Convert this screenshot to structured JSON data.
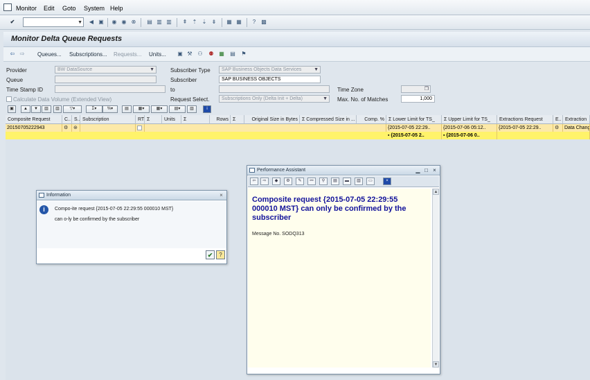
{
  "menu": [
    "Monitor",
    "Edit",
    "Goto",
    "System",
    "Help"
  ],
  "title": "Monitor Delta Queue Requests",
  "app_toolbar": {
    "queues": "Queues...",
    "subscriptions": "Subscriptions...",
    "requests": "Requests...",
    "units": "Units..."
  },
  "form": {
    "provider_label": "Provider",
    "provider_value": "BW DataSource",
    "queue_label": "Queue",
    "timestamp_label": "Time Stamp ID",
    "calc_label": "Calculate Data Volume (Extended View)",
    "subtype_label": "Subscriber Type",
    "subtype_value": "SAP Business Objects Data Services",
    "subscriber_label": "Subscriber",
    "subscriber_value": "SAP BUSINESS OBJECTS",
    "to_label": "to",
    "reqsel_label": "Request Select.",
    "reqsel_value": "Subscriptions Only (Delta Init + Delta)",
    "timezone_label": "Time Zone",
    "maxmatch_label": "Max. No. of Matches",
    "maxmatch_value": "1,000"
  },
  "grid": {
    "headers": [
      "Composite Request",
      "C..",
      "S..",
      "Subscription",
      "RT",
      "Σ",
      "Units",
      "Σ",
      "Rows",
      "Σ",
      "Original Size in Bytes",
      "Σ Compressed Size in ...",
      "Comp. %",
      "Σ Lower Limit for TS_",
      "Σ Upper Limit for TS_",
      "Extractions Request",
      "E..",
      "Extraction"
    ],
    "row1": {
      "composite": "20150705222943",
      "lower": "{2015-07-05 22:29..",
      "upper": "{2015-07-06 05:12..",
      "extract": "{2015-07-05 22:29..",
      "extraction": "Data Chang"
    },
    "row2": {
      "lower": "▪ {2015-07-05 2..",
      "upper": "▪ {2015-07-06 0.."
    }
  },
  "info_dialog": {
    "title": "Information",
    "line1": "Compo-ite request {2015-07-05 22:29:55 000010 MST}",
    "line2": "can o-ly be confirmed by the subscriber"
  },
  "perf_dialog": {
    "title": "Performance Assistant",
    "heading": "Composite request {2015-07-05 22:29:55 000010 MST} can only be confirmed by the subscriber",
    "message": "Message No. SODQ313"
  },
  "colors": {
    "accent": "#12129a",
    "row": "#fce9a8",
    "sum_row": "#fff36a"
  }
}
